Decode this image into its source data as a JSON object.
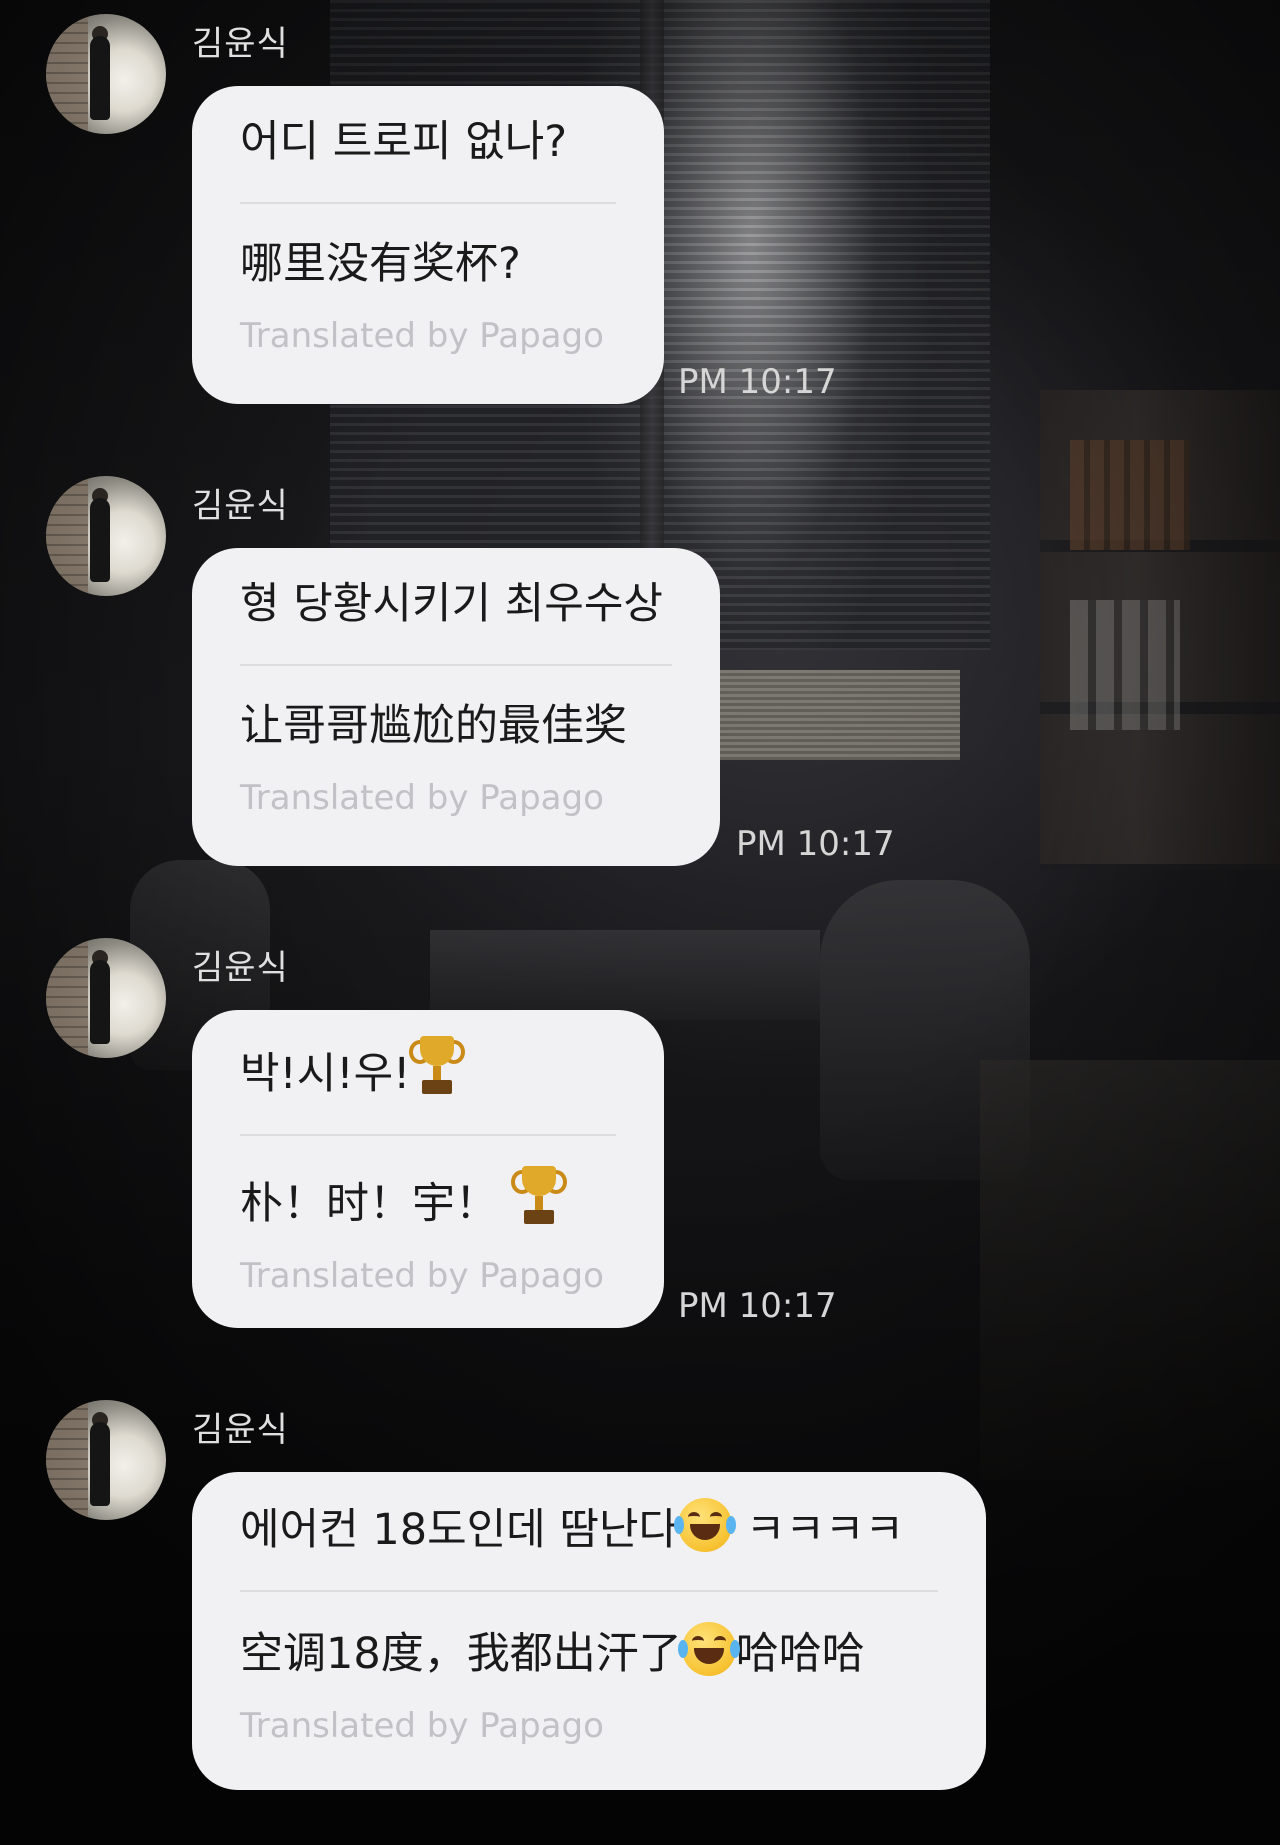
{
  "messages": [
    {
      "sender": "김윤식",
      "original": "어디 트로피 없나?",
      "translated": "哪里没有奖杯?",
      "credit": "Translated by Papago",
      "time": "PM 10:17"
    },
    {
      "sender": "김윤식",
      "original": "형 당황시키기 최우수상",
      "translated": "让哥哥尴尬的最佳奖",
      "credit": "Translated by Papago",
      "time": "PM 10:17"
    },
    {
      "sender": "김윤식",
      "original": "박!시!우!",
      "translated": "朴！时！宇！",
      "credit": "Translated by Papago",
      "time": "PM 10:17",
      "emoji": "trophy-icon"
    },
    {
      "sender": "김윤식",
      "original_a": "에어컨 18도인데 땀난다",
      "original_b": "ㅋㅋㅋㅋ",
      "translated_a": "空调18度，我都出汗了",
      "translated_b": "哈哈哈",
      "credit": "Translated by Papago",
      "emoji": "laughing-tears-icon"
    }
  ]
}
